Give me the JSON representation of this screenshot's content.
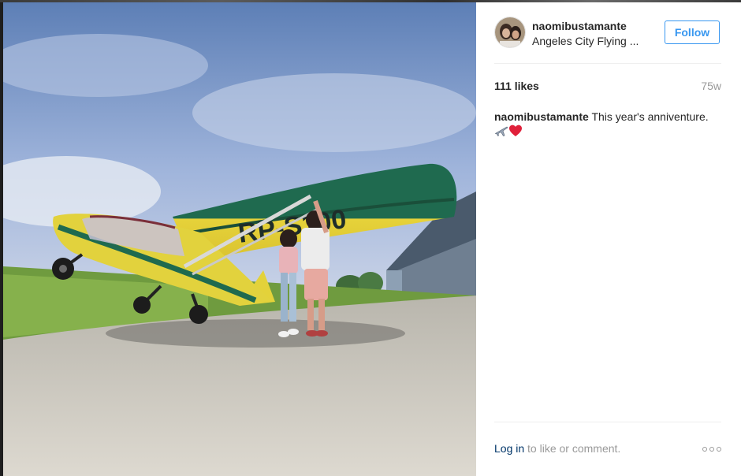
{
  "post": {
    "username": "naomibustamante",
    "location": "Angeles City Flying ...",
    "follow_label": "Follow",
    "likes": "111 likes",
    "age": "75w",
    "caption_user": "naomibustamante",
    "caption_text": "This year's anniventure.",
    "caption_emojis": [
      "airplane-emoji",
      "heart-emoji"
    ],
    "plane_registration": "RP-S100",
    "login_link": "Log in",
    "login_rest": "to like or comment.",
    "more_icon": "more-options-icon"
  },
  "colors": {
    "accent": "#3897f0",
    "text": "#262626",
    "muted": "#999999",
    "link": "#003569",
    "heart": "#e0203a"
  }
}
